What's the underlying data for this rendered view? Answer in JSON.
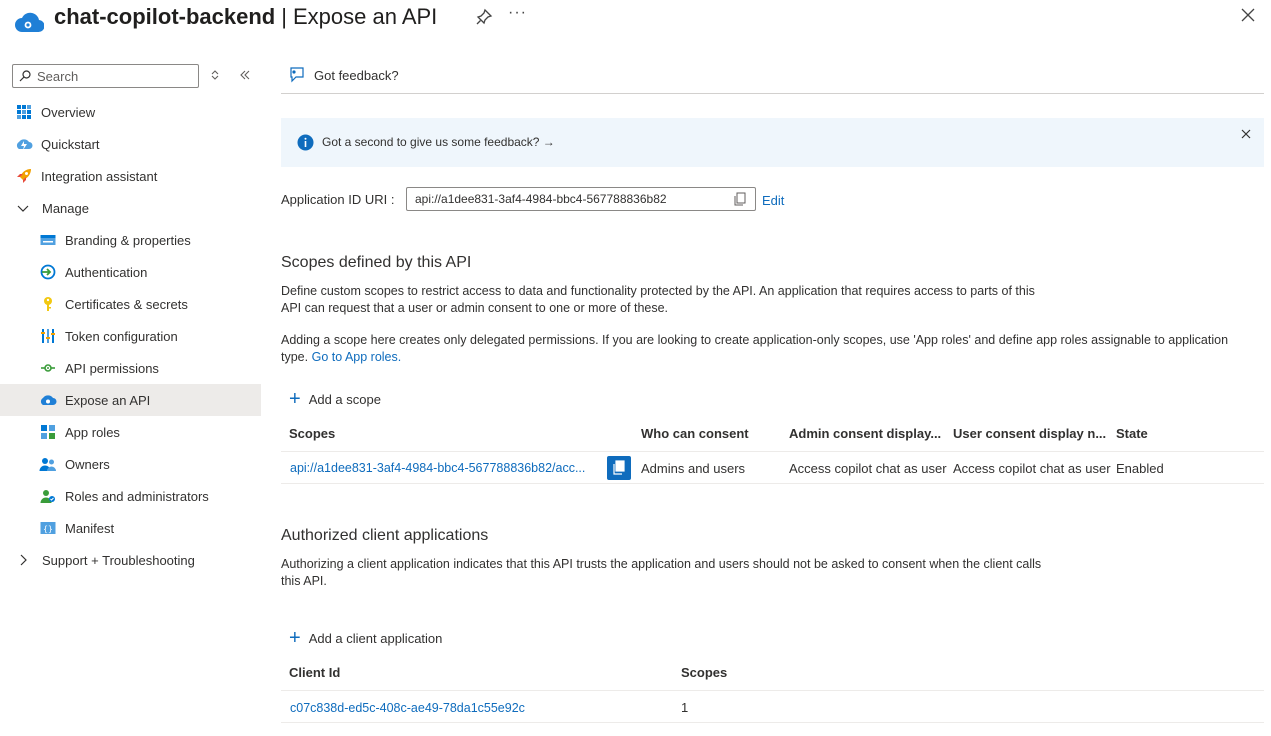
{
  "header": {
    "resource_name": "chat-copilot-backend",
    "separator": "|",
    "page_name": "Expose an API",
    "more_label": "···"
  },
  "sidebar": {
    "search_placeholder": "Search",
    "items": [
      {
        "label": "Overview",
        "icon": "overview-icon"
      },
      {
        "label": "Quickstart",
        "icon": "quickstart-icon"
      },
      {
        "label": "Integration assistant",
        "icon": "rocket-icon"
      },
      {
        "label": "Manage",
        "icon": "chevron-down-icon"
      },
      {
        "label": "Branding & properties",
        "icon": "branding-icon"
      },
      {
        "label": "Authentication",
        "icon": "authentication-icon"
      },
      {
        "label": "Certificates & secrets",
        "icon": "key-icon"
      },
      {
        "label": "Token configuration",
        "icon": "token-icon"
      },
      {
        "label": "API permissions",
        "icon": "api-permissions-icon"
      },
      {
        "label": "Expose an API",
        "icon": "cloud-icon"
      },
      {
        "label": "App roles",
        "icon": "app-roles-icon"
      },
      {
        "label": "Owners",
        "icon": "owners-icon"
      },
      {
        "label": "Roles and administrators",
        "icon": "roles-icon"
      },
      {
        "label": "Manifest",
        "icon": "manifest-icon"
      },
      {
        "label": "Support + Troubleshooting",
        "icon": "chevron-right-icon"
      }
    ]
  },
  "toolbar": {
    "feedback_label": "Got feedback?"
  },
  "banner": {
    "text": "Got a second to give us some feedback? →"
  },
  "app_id": {
    "label": "Application ID URI :",
    "value": "api://a1dee831-3af4-4984-bbc4-567788836b82",
    "edit_label": "Edit"
  },
  "scopes_section": {
    "title": "Scopes defined by this API",
    "desc_line1": "Define custom scopes to restrict access to data and functionality protected by the API. An application that requires access to parts of this",
    "desc_line2": "API can request that a user or admin consent to one or more of these.",
    "note_line1": "Adding a scope here creates only delegated permissions. If you are looking to create application-only scopes, use 'App roles' and define app roles assignable to application",
    "note_line2_prefix": "type.",
    "note_link": "Go to App roles.",
    "add_label": "Add a scope",
    "columns": [
      "Scopes",
      "Who can consent",
      "Admin consent display...",
      "User consent display n...",
      "State"
    ],
    "rows": [
      {
        "scope": "api://a1dee831-3af4-4984-bbc4-567788836b82/acc...",
        "who": "Admins and users",
        "admin_display": "Access copilot chat as user",
        "user_display": "Access copilot chat as user",
        "state": "Enabled"
      }
    ]
  },
  "clients_section": {
    "title": "Authorized client applications",
    "desc_line1": "Authorizing a client application indicates that this API trusts the application and users should not be asked to consent when the client calls",
    "desc_line2": "this API.",
    "add_label": "Add a client application",
    "columns": [
      "Client Id",
      "Scopes"
    ],
    "rows": [
      {
        "client_id": "c07c838d-ed5c-408c-ae49-78da1c55e92c",
        "scopes": "1"
      }
    ]
  },
  "colors": {
    "accent": "#0f6cbd",
    "banner_bg": "#eff6fc",
    "active_bg": "#edebe9"
  }
}
